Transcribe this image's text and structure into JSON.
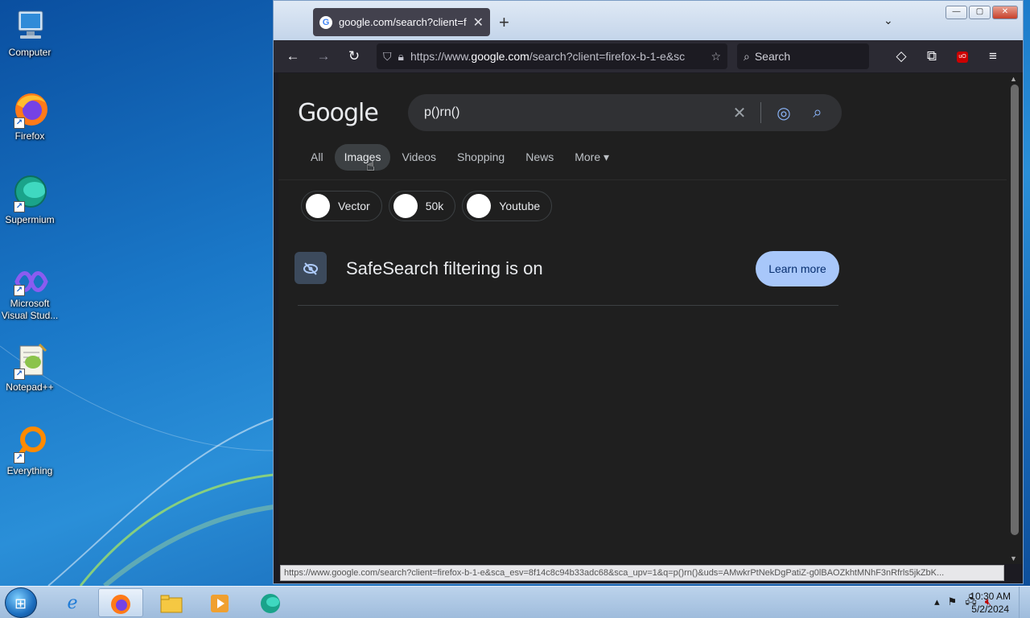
{
  "desktop": {
    "icons": [
      {
        "label": "Computer",
        "icon": "computer-icon"
      },
      {
        "label": "Firefox",
        "icon": "firefox-icon"
      },
      {
        "label": "Supermium",
        "icon": "supermium-icon"
      },
      {
        "label": "Microsoft Visual Stud...",
        "icon": "visual-studio-icon"
      },
      {
        "label": "Notepad++",
        "icon": "notepadpp-icon"
      },
      {
        "label": "Everything",
        "icon": "everything-icon"
      }
    ]
  },
  "browser": {
    "tab_title": "google.com/search?client=firef",
    "tab_close": "✕",
    "new_tab": "+",
    "tab_list": "⌄",
    "url_prefix": "https://www.",
    "url_host": "google.com",
    "url_rest": "/search?client=firefox-b-1-e&sc",
    "search_placeholder": "Search",
    "window_buttons": {
      "minimize": "—",
      "maximize": "▢",
      "close": "✕"
    }
  },
  "google": {
    "logo": "Google",
    "query": "p()rn()",
    "tabs": [
      {
        "label": "All",
        "active": false
      },
      {
        "label": "Images",
        "active": true
      },
      {
        "label": "Videos",
        "active": false
      },
      {
        "label": "Shopping",
        "active": false
      },
      {
        "label": "News",
        "active": false
      },
      {
        "label": "More ▾",
        "active": false
      }
    ],
    "chips": [
      "Vector",
      "50k",
      "Youtube"
    ],
    "safesearch_text": "SafeSearch filtering is on",
    "learn_more": "Learn more"
  },
  "status_url": "https://www.google.com/search?client=firefox-b-1-e&sca_esv=8f14c8c94b33adc68&sca_upv=1&q=p()rn()&uds=AMwkrPtNekDgPatiZ-g0lBAOZkhtMNhF3nRfrls5jkZbK...",
  "taskbar": {
    "clock_time": "10:30 AM",
    "clock_date": "5/2/2024"
  },
  "colors": {
    "page_bg": "#1f1f1f",
    "accent_button": "#a8c7fa",
    "link_blue": "#8ab4f8"
  }
}
